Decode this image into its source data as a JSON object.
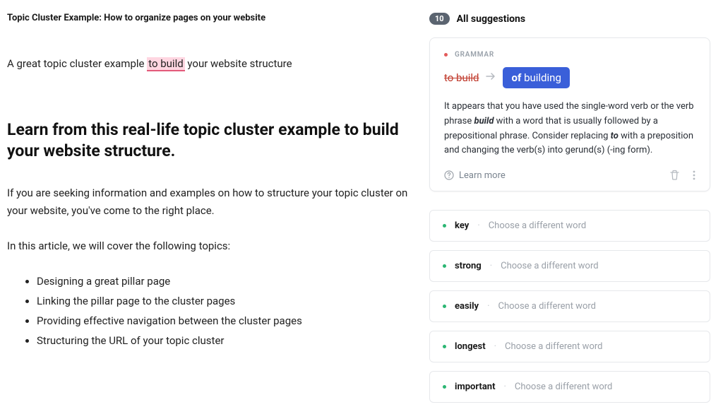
{
  "editor": {
    "doc_title": "Topic Cluster Example: How to organize pages on your website",
    "intro_prefix": "A great  topic cluster example ",
    "intro_highlight": "to build",
    "intro_suffix": " your website structure",
    "heading": "Learn from this real-life topic cluster example to build your website structure.",
    "p1": "If you are seeking information and examples on how to structure your topic cluster on your website, you've come to the right place.",
    "p2": "In this article, we will cover the following topics:",
    "bullets": [
      "Designing a great pillar page",
      "Linking the pillar page to the cluster pages",
      "Providing effective navigation between the cluster pages",
      "Structuring the URL of your topic cluster"
    ]
  },
  "sidebar": {
    "count": "10",
    "title": "All suggestions",
    "card": {
      "category": "GRAMMAR",
      "original": "to build",
      "replace_plain": "of ",
      "replace_bold": "building",
      "explanation_parts": {
        "t1": "It appears that you have used the single-word verb or the verb phrase ",
        "em1": "build",
        "t2": " with a word that is usually followed by a prepositional phrase. Consider replacing ",
        "em2": "to",
        "t3": " with a preposition and changing the verb(s) into gerund(s) (-ing form)."
      },
      "learn_more": "Learn more"
    },
    "minis": [
      {
        "word": "key",
        "hint": "Choose a different word"
      },
      {
        "word": "strong",
        "hint": "Choose a different word"
      },
      {
        "word": "easily",
        "hint": "Choose a different word"
      },
      {
        "word": "longest",
        "hint": "Choose a different word"
      },
      {
        "word": "important",
        "hint": "Choose a different word"
      }
    ]
  }
}
